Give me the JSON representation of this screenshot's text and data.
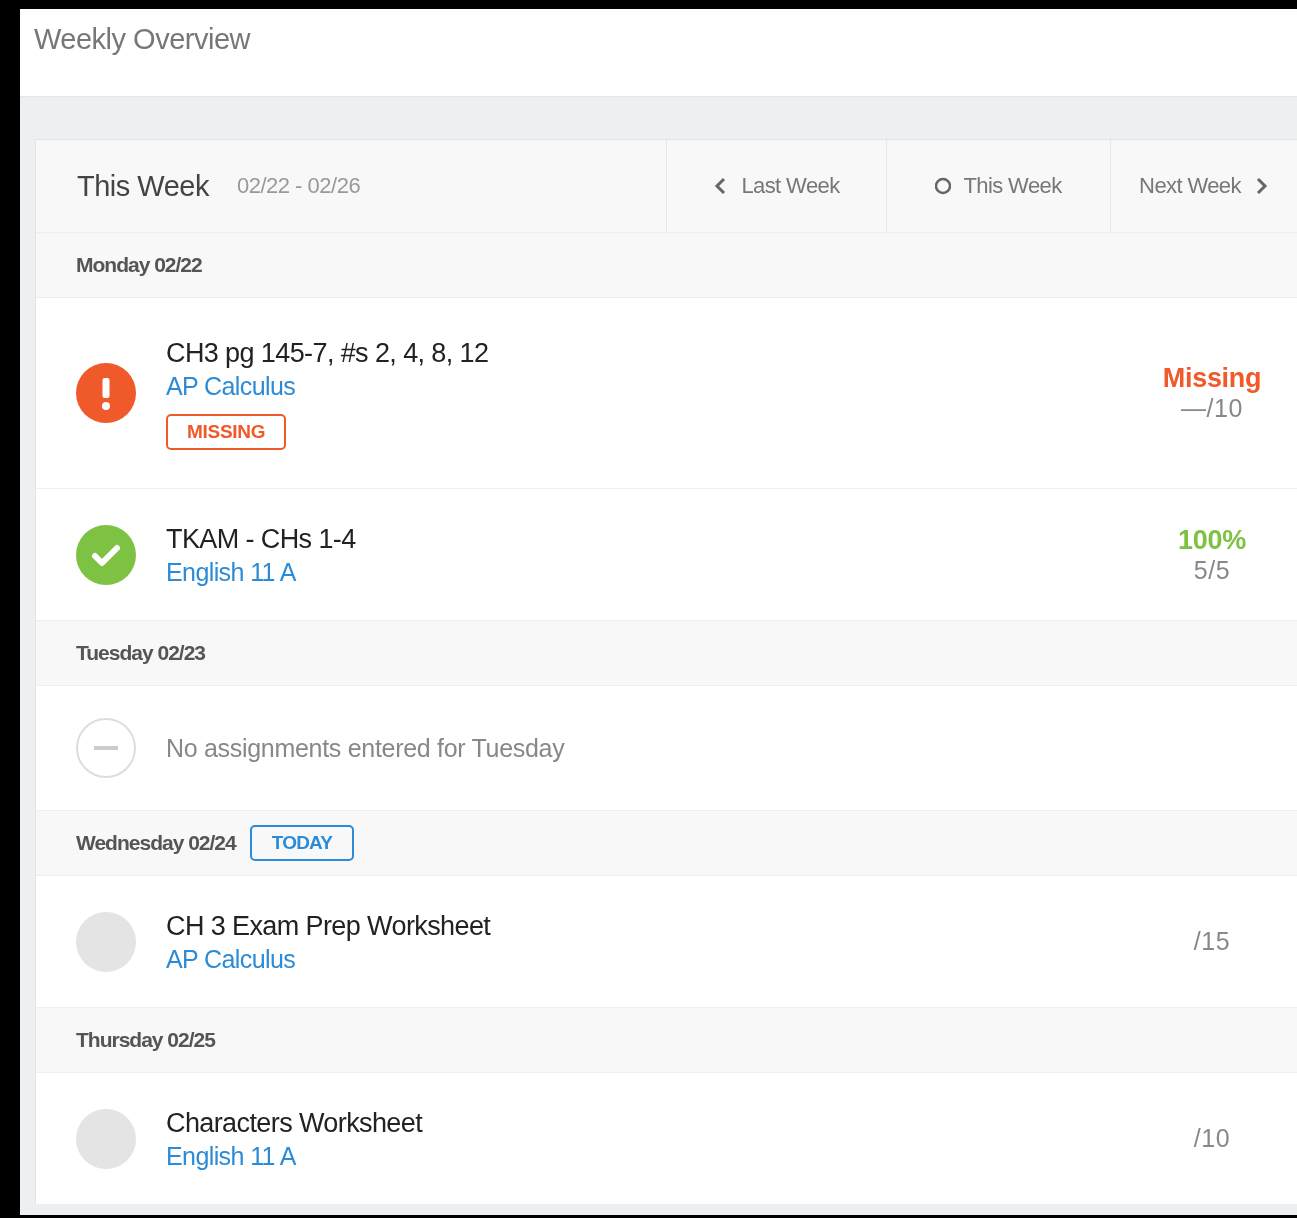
{
  "header": {
    "title": "Weekly Overview"
  },
  "week": {
    "title": "This Week",
    "range": "02/22 - 02/26",
    "nav": [
      {
        "kind": "prev",
        "label": "Last Week"
      },
      {
        "kind": "current",
        "label": "This Week"
      },
      {
        "kind": "next",
        "label": "Next Week"
      }
    ]
  },
  "days": [
    {
      "label": "Monday 02/22",
      "items": [
        {
          "kind": "missing",
          "title": "CH3 pg 145-7, #s 2, 4, 8, 12",
          "course": "AP Calculus",
          "tag": "MISSING",
          "grade": "Missing",
          "score": "—/10"
        },
        {
          "kind": "complete",
          "title": "TKAM - CHs 1-4",
          "course": "English 11 A",
          "grade": "100%",
          "score": "5/5"
        }
      ]
    },
    {
      "label": "Tuesday 02/23",
      "items": [
        {
          "kind": "empty",
          "text": "No assignments entered for Tuesday"
        }
      ]
    },
    {
      "label": "Wednesday 02/24",
      "badge": "TODAY",
      "items": [
        {
          "kind": "pending",
          "title": "CH 3 Exam Prep Worksheet",
          "course": "AP Calculus",
          "score": "/15"
        }
      ]
    },
    {
      "label": "Thursday 02/25",
      "items": [
        {
          "kind": "pending",
          "title": "Characters Worksheet",
          "course": "English 11 A",
          "score": "/10"
        }
      ]
    }
  ]
}
